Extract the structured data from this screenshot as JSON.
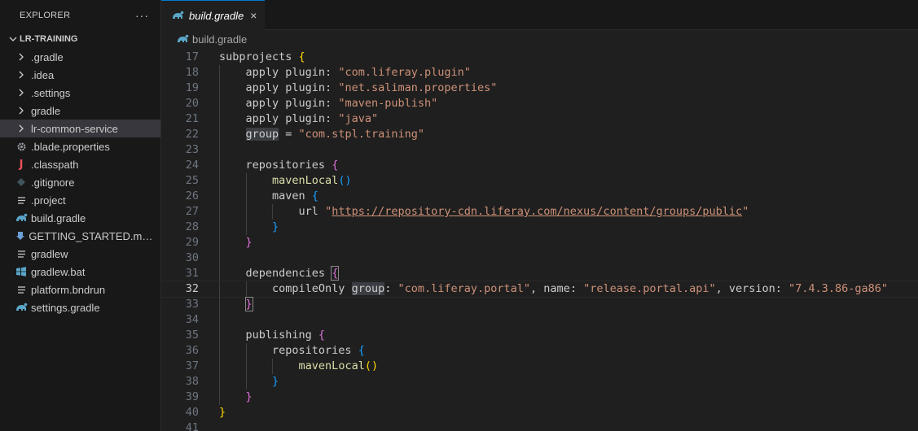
{
  "explorer": {
    "title": "EXPLORER",
    "more": "···",
    "root": "LR-TRAINING",
    "items": [
      {
        "label": ".gradle",
        "kind": "folder",
        "icon": "chevron-right-icon"
      },
      {
        "label": ".idea",
        "kind": "folder",
        "icon": "chevron-right-icon"
      },
      {
        "label": ".settings",
        "kind": "folder",
        "icon": "chevron-right-icon"
      },
      {
        "label": "gradle",
        "kind": "folder",
        "icon": "chevron-right-icon"
      },
      {
        "label": "lr-common-service",
        "kind": "folder",
        "icon": "chevron-right-icon",
        "selected": true
      },
      {
        "label": ".blade.properties",
        "kind": "file",
        "icon": "gear-icon"
      },
      {
        "label": ".classpath",
        "kind": "file",
        "icon": "java-icon"
      },
      {
        "label": ".gitignore",
        "kind": "file",
        "icon": "git-icon"
      },
      {
        "label": ".project",
        "kind": "file",
        "icon": "lines-icon"
      },
      {
        "label": "build.gradle",
        "kind": "file",
        "icon": "gradle-icon"
      },
      {
        "label": "GETTING_STARTED.markdown",
        "kind": "file",
        "icon": "markdown-icon"
      },
      {
        "label": "gradlew",
        "kind": "file",
        "icon": "lines-icon"
      },
      {
        "label": "gradlew.bat",
        "kind": "file",
        "icon": "windows-icon"
      },
      {
        "label": "platform.bndrun",
        "kind": "file",
        "icon": "lines-icon"
      },
      {
        "label": "settings.gradle",
        "kind": "file",
        "icon": "gradle-icon"
      }
    ]
  },
  "tab": {
    "label": "build.gradle",
    "close": "×"
  },
  "breadcrumb": {
    "file": "build.gradle"
  },
  "editor": {
    "current_line": 32,
    "lines": [
      {
        "n": "17",
        "indent": 0,
        "t": [
          [
            "id",
            "subprojects "
          ],
          [
            "br1",
            "{"
          ]
        ]
      },
      {
        "n": "18",
        "indent": 1,
        "t": [
          [
            "id",
            "apply plugin: "
          ],
          [
            "str",
            "\"com.liferay.plugin\""
          ]
        ]
      },
      {
        "n": "19",
        "indent": 1,
        "t": [
          [
            "id",
            "apply plugin: "
          ],
          [
            "str",
            "\"net.saliman.properties\""
          ]
        ]
      },
      {
        "n": "20",
        "indent": 1,
        "t": [
          [
            "id",
            "apply plugin: "
          ],
          [
            "str",
            "\"maven-publish\""
          ]
        ]
      },
      {
        "n": "21",
        "indent": 1,
        "t": [
          [
            "id",
            "apply plugin: "
          ],
          [
            "str",
            "\"java\""
          ]
        ]
      },
      {
        "n": "22",
        "indent": 1,
        "t": [
          [
            "hl",
            "group"
          ],
          [
            "id",
            " = "
          ],
          [
            "str",
            "\"com.stpl.training\""
          ]
        ]
      },
      {
        "n": "23",
        "indent": 1,
        "t": []
      },
      {
        "n": "24",
        "indent": 1,
        "t": [
          [
            "id",
            "repositories "
          ],
          [
            "br2",
            "{"
          ]
        ]
      },
      {
        "n": "25",
        "indent": 2,
        "t": [
          [
            "fn",
            "mavenLocal"
          ],
          [
            "br3",
            "()"
          ]
        ]
      },
      {
        "n": "26",
        "indent": 2,
        "t": [
          [
            "id",
            "maven "
          ],
          [
            "br3",
            "{"
          ]
        ]
      },
      {
        "n": "27",
        "indent": 3,
        "t": [
          [
            "id",
            "url "
          ],
          [
            "str",
            "\""
          ],
          [
            "url",
            "https://repository-cdn.liferay.com/nexus/content/groups/public"
          ],
          [
            "str",
            "\""
          ]
        ]
      },
      {
        "n": "28",
        "indent": 2,
        "t": [
          [
            "br3",
            "}"
          ]
        ]
      },
      {
        "n": "29",
        "indent": 1,
        "t": [
          [
            "br2",
            "}"
          ]
        ]
      },
      {
        "n": "30",
        "indent": 1,
        "t": []
      },
      {
        "n": "31",
        "indent": 1,
        "t": [
          [
            "id",
            "dependencies "
          ],
          [
            "br2bm",
            "{"
          ]
        ]
      },
      {
        "n": "32",
        "indent": 2,
        "t": [
          [
            "id",
            "compileOnly "
          ],
          [
            "hl",
            "group"
          ],
          [
            "id",
            ": "
          ],
          [
            "str",
            "\"com.liferay.portal\""
          ],
          [
            "id",
            ", name: "
          ],
          [
            "str",
            "\"release.portal.api\""
          ],
          [
            "id",
            ", version: "
          ],
          [
            "str",
            "\"7.4.3.86-ga86\""
          ]
        ]
      },
      {
        "n": "33",
        "indent": 1,
        "t": [
          [
            "br2bm",
            "}"
          ]
        ]
      },
      {
        "n": "34",
        "indent": 1,
        "t": []
      },
      {
        "n": "35",
        "indent": 1,
        "t": [
          [
            "id",
            "publishing "
          ],
          [
            "br2",
            "{"
          ]
        ]
      },
      {
        "n": "36",
        "indent": 2,
        "t": [
          [
            "id",
            "repositories "
          ],
          [
            "br3",
            "{"
          ]
        ]
      },
      {
        "n": "37",
        "indent": 3,
        "t": [
          [
            "fn",
            "mavenLocal"
          ],
          [
            "br1",
            "()"
          ]
        ]
      },
      {
        "n": "38",
        "indent": 2,
        "t": [
          [
            "br3",
            "}"
          ]
        ]
      },
      {
        "n": "39",
        "indent": 1,
        "t": [
          [
            "br2",
            "}"
          ]
        ]
      },
      {
        "n": "40",
        "indent": 0,
        "t": [
          [
            "br1",
            "}"
          ]
        ]
      },
      {
        "n": "41",
        "indent": 0,
        "t": []
      }
    ]
  },
  "colors": {
    "accent": "#0078d4",
    "string": "#ce9178",
    "bracket1": "#ffd700",
    "bracket2": "#da70d6",
    "bracket3": "#179fff"
  }
}
